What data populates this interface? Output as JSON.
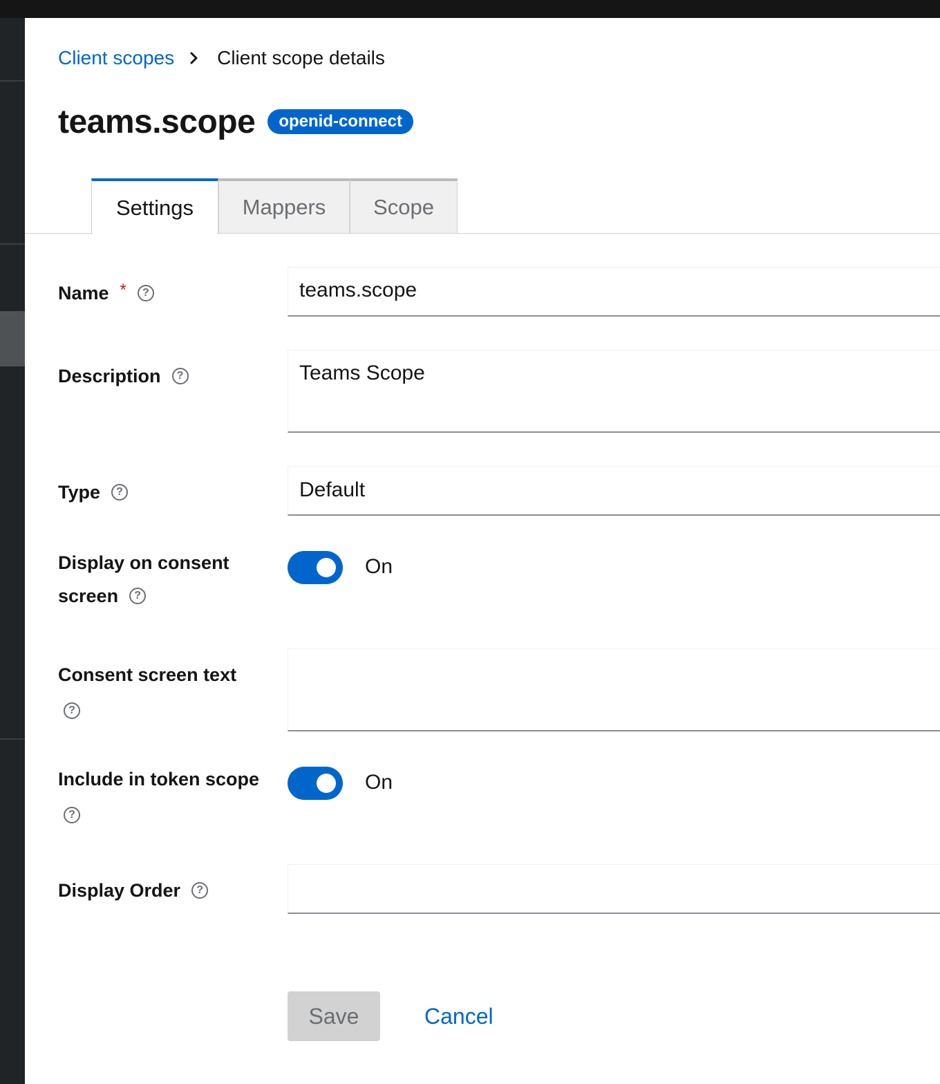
{
  "breadcrumb": {
    "parent": "Client scopes",
    "current": "Client scope details"
  },
  "header": {
    "title": "teams.scope",
    "badge": "openid-connect"
  },
  "tabs": [
    {
      "label": "Settings",
      "active": true
    },
    {
      "label": "Mappers",
      "active": false
    },
    {
      "label": "Scope",
      "active": false
    }
  ],
  "form": {
    "name": {
      "label": "Name",
      "required_mark": "*",
      "value": "teams.scope"
    },
    "description": {
      "label": "Description",
      "value": "Teams Scope"
    },
    "type": {
      "label": "Type",
      "value": "Default"
    },
    "display_on_consent": {
      "label_line1": "Display on consent",
      "label_line2": "screen",
      "state": "On",
      "on": true
    },
    "consent_text": {
      "label": "Consent screen text",
      "value": ""
    },
    "include_in_token": {
      "label": "Include in token scope",
      "state": "On",
      "on": true
    },
    "display_order": {
      "label": "Display Order",
      "value": ""
    }
  },
  "actions": {
    "save": "Save",
    "cancel": "Cancel"
  },
  "colors": {
    "accent": "#0066cc",
    "required": "#c9190b",
    "topbar": "#151515",
    "sidenav": "#212427"
  },
  "icons": {
    "help": "help-circle-icon",
    "breadcrumb_separator": "chevron-right-icon"
  }
}
